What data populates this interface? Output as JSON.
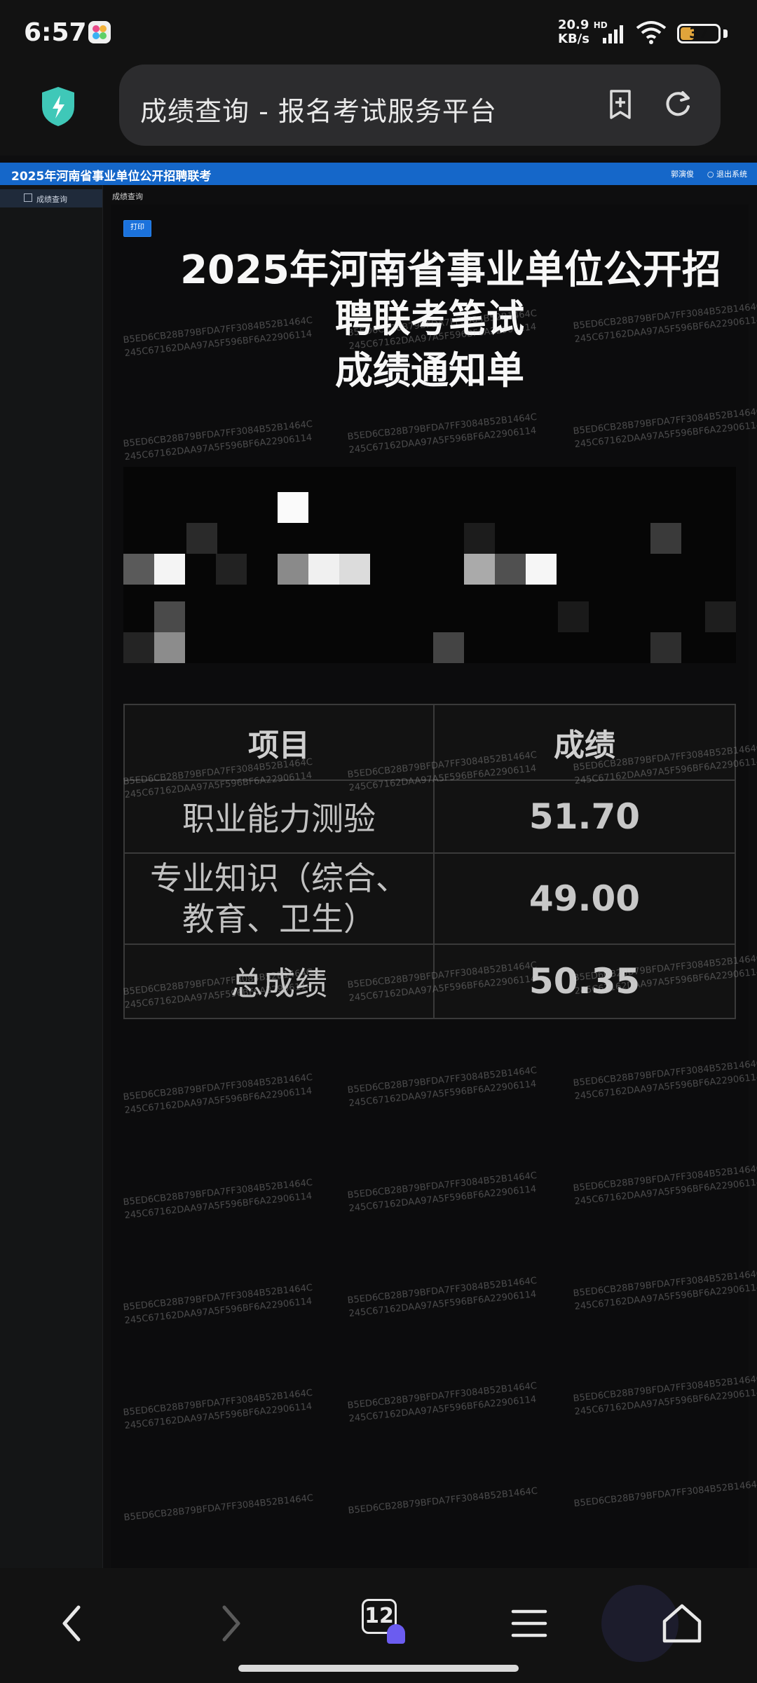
{
  "status_bar": {
    "time": "6:57",
    "net_speed_value": "20.9",
    "net_speed_unit": "KB/s",
    "net_type": "HD",
    "battery": "37"
  },
  "browser": {
    "page_title": "成绩查询 - 报名考试服务平台"
  },
  "site": {
    "header_title": "2025年河南省事业单位公开招聘联考",
    "user_label": "郭演俊",
    "logout_label": "退出系统",
    "sidebar_item": "成绩查询",
    "breadcrumb": "成绩查询",
    "print_button": "打印"
  },
  "notice": {
    "title_line1": "2025年河南省事业单位公开招",
    "title_line2": "聘联考笔试",
    "title_line3": "成绩通知单"
  },
  "watermark": {
    "line1": "B5ED6CB28B79BFDA7FF3084B52B1464C",
    "line2": "245C67162DAA97A5F596BF6A22906114"
  },
  "score_table": {
    "headers": [
      "项目",
      "成绩"
    ],
    "rows": [
      {
        "item": "职业能力测验",
        "score": "51.70"
      },
      {
        "item": "专业知识（综合、教育、卫生）",
        "score": "49.00"
      },
      {
        "item": "总成绩",
        "score": "50.35"
      }
    ]
  },
  "bottom_nav": {
    "tab_count": "12"
  },
  "colors": {
    "site_header": "#1567c9",
    "print_button": "#1b72dc",
    "shield": "#3fc8b8",
    "battery_fill": "#e0a43b",
    "ghost": "#6b5cf0"
  }
}
